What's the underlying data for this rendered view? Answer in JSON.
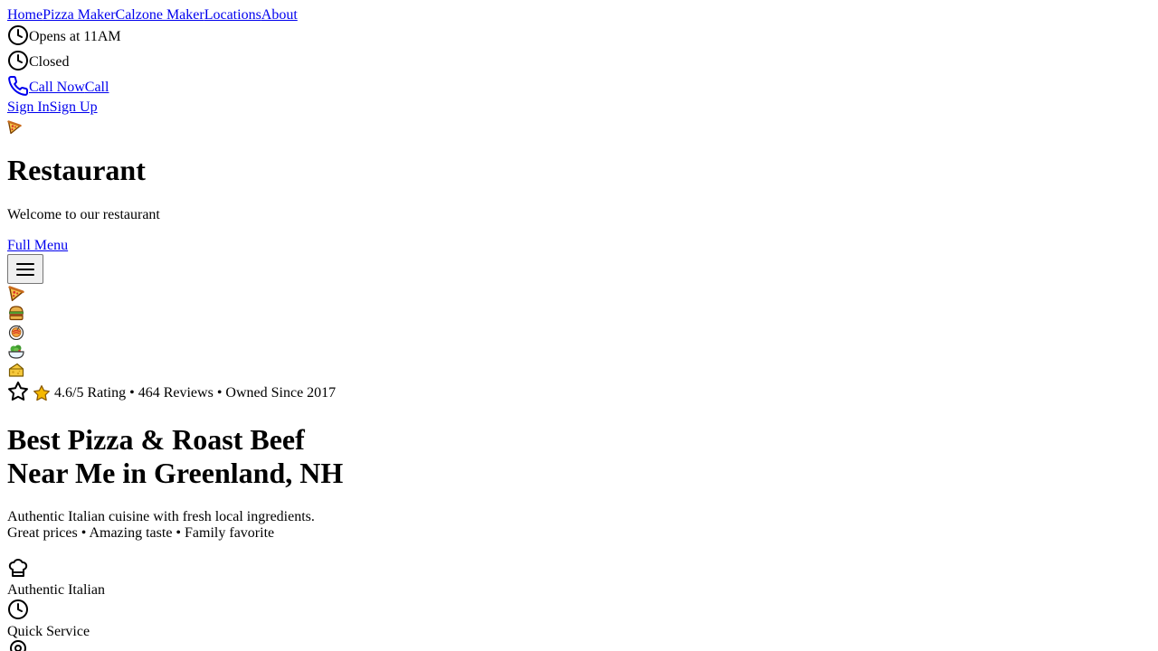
{
  "nav": {
    "links": [
      "Home",
      "Pizza Maker",
      "Calzone Maker",
      "Locations",
      "About"
    ]
  },
  "hours": [
    {
      "icon": "clock-icon",
      "text": "Opens at 11AM"
    },
    {
      "icon": "clock-icon",
      "text": "Closed"
    }
  ],
  "phone": {
    "icon": "phone-icon",
    "label": "Call Now",
    "short_label": "Call"
  },
  "auth": {
    "sign_in": "Sign In",
    "sign_up": "Sign Up"
  },
  "brand": {
    "icon": "pizza-icon",
    "title": "Restaurant",
    "tagline": "Welcome to our restaurant"
  },
  "menu": {
    "full_menu_label": "Full Menu",
    "toggle_icon": "hamburger-menu-icon"
  },
  "food_icons": [
    "pizza-icon",
    "sandwich-icon",
    "pasta-icon",
    "salad-icon",
    "cheese-icon"
  ],
  "rating": {
    "icon": "star-outline-icon",
    "star_icon": "star-icon",
    "text": "4.6/5 Rating • 464 Reviews • Owned Since 2017"
  },
  "hero": {
    "title_line1": "Best Pizza & Roast Beef",
    "title_line2": "Near Me in Greenland, NH",
    "desc_line1": "Authentic Italian cuisine with fresh local ingredients.",
    "desc_line2": "Great prices • Amazing taste • Family favorite"
  },
  "features": [
    {
      "icon": "chef-hat-icon",
      "label": "Authentic Italian"
    },
    {
      "icon": "clock-icon",
      "label": "Quick Service"
    },
    {
      "icon": "pin-icon",
      "label": ""
    }
  ],
  "colors": {
    "link": "#0000ee",
    "phone_icon": "#0000ee",
    "star": "#f5b800",
    "star_stroke": "#8a5a00"
  }
}
